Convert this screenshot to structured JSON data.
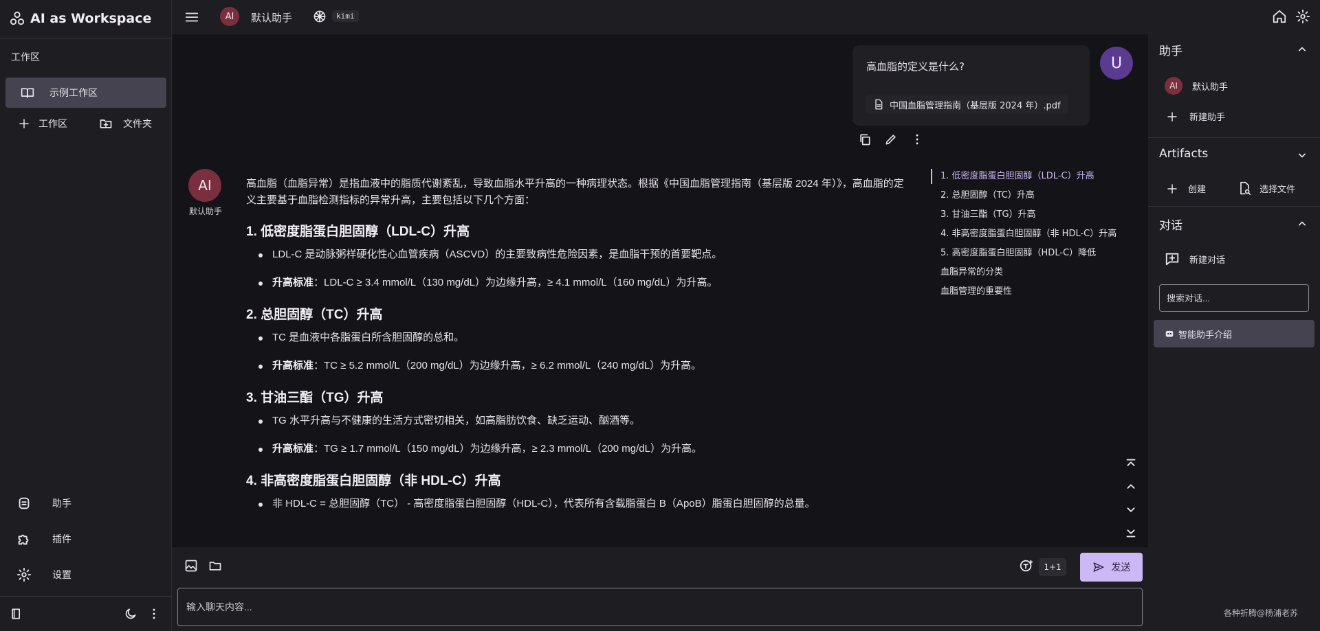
{
  "app": {
    "title": "AI as Workspace"
  },
  "left_sidebar": {
    "workspace_heading": "工作区",
    "active_workspace": "示例工作区",
    "add_workspace": "工作区",
    "add_folder": "文件夹",
    "nav": [
      {
        "label": "助手",
        "icon": "robot-icon"
      },
      {
        "label": "插件",
        "icon": "puzzle-icon"
      },
      {
        "label": "设置",
        "icon": "gear-icon"
      }
    ]
  },
  "topbar": {
    "assistant_avatar": "AI",
    "assistant_name": "默认助手",
    "model": "kimi"
  },
  "chat": {
    "user_avatar": "U",
    "user_question": "高血脂的定义是什么?",
    "attachment": "中国血脂管理指南（基层版 2024 年）.pdf",
    "bot_avatar": "AI",
    "bot_name": "默认助手",
    "intro": "高血脂（血脂异常）是指血液中的脂质代谢紊乱，导致血脂水平升高的一种病理状态。根据《中国血脂管理指南（基层版 2024 年）》，高血脂的定义主要基于血脂检测指标的异常升高，主要包括以下几个方面：",
    "sections": [
      {
        "heading": "1. 低密度脂蛋白胆固醇（LDL-C）升高",
        "item1": "LDL-C 是动脉粥样硬化性心血管疾病（ASCVD）的主要致病性危险因素，是血脂干预的首要靶点。",
        "item2_label": "升高标准",
        "item2_text": "：LDL-C ≥ 3.4 mmol/L（130 mg/dL）为边缘升高，≥ 4.1 mmol/L（160 mg/dL）为升高。"
      },
      {
        "heading": "2. 总胆固醇（TC）升高",
        "item1": "TC 是血液中各脂蛋白所含胆固醇的总和。",
        "item2_label": "升高标准",
        "item2_text": "：TC ≥ 5.2 mmol/L（200 mg/dL）为边缘升高，≥ 6.2 mmol/L（240 mg/dL）为升高。"
      },
      {
        "heading": "3. 甘油三酯（TG）升高",
        "item1": "TG 水平升高与不健康的生活方式密切相关，如高脂肪饮食、缺乏运动、酗酒等。",
        "item2_label": "升高标准",
        "item2_text": "：TG ≥ 1.7 mmol/L（150 mg/dL）为边缘升高，≥ 2.3 mmol/L（200 mg/dL）为升高。"
      },
      {
        "heading": "4. 非高密度脂蛋白胆固醇（非 HDL-C）升高",
        "item1": "非 HDL-C = 总胆固醇（TC） - 高密度脂蛋白胆固醇（HDL-C），代表所有含载脂蛋白 B（ApoB）脂蛋白胆固醇的总量。"
      }
    ],
    "toc": [
      "1. 低密度脂蛋白胆固醇（LDL-C）升高",
      "2. 总胆固醇（TC）升高",
      "3. 甘油三酯（TG）升高",
      "4. 非高密度脂蛋白胆固醇（非 HDL-C）升高",
      "5. 高密度脂蛋白胆固醇（HDL-C）降低",
      "血脂异常的分类",
      "血脂管理的重要性"
    ]
  },
  "composer": {
    "ratio": "1+1",
    "send_label": "发送",
    "placeholder": "输入聊天内容..."
  },
  "right_sidebar": {
    "assistant_section": "助手",
    "assistant_avatar": "AI",
    "assistant_name": "默认助手",
    "new_assistant": "新建助手",
    "artifacts_section": "Artifacts",
    "create": "创建",
    "choose_file": "选择文件",
    "conversation_section": "对话",
    "new_conversation": "新建对话",
    "search_placeholder": "搜索对话...",
    "conversation_item": "智能助手介绍"
  },
  "watermark": "各种折腾@杨浦老苏",
  "colors": {
    "accent": "#cdb8f6",
    "toc_active": "#c9b8f4",
    "avatar_ai": "#7a2f3e",
    "avatar_user": "#5b3b8f"
  }
}
